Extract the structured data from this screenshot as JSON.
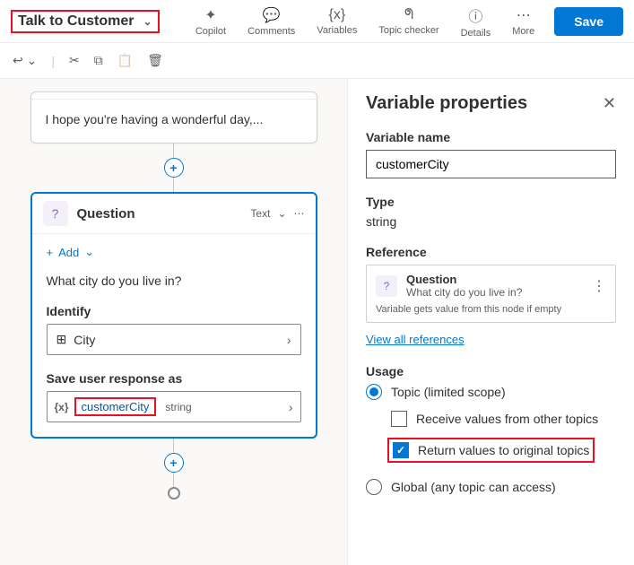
{
  "header": {
    "topic_name": "Talk to Customer",
    "tools": {
      "copilot": "Copilot",
      "comments": "Comments",
      "variables": "Variables",
      "topic_checker": "Topic checker",
      "details": "Details",
      "more": "More"
    },
    "save": "Save"
  },
  "canvas": {
    "message_text": "I hope you're having a wonderful day,...",
    "question": {
      "title": "Question",
      "type_label": "Text",
      "add_label": "Add",
      "prompt": "What city do you live in?",
      "identify_label": "Identify",
      "identify_value": "City",
      "save_response_label": "Save user response as",
      "variable_name": "customerCity",
      "variable_type": "string"
    }
  },
  "panel": {
    "title": "Variable properties",
    "name_label": "Variable name",
    "name_value": "customerCity",
    "type_label": "Type",
    "type_value": "string",
    "reference_label": "Reference",
    "reference": {
      "title": "Question",
      "subtitle": "What city do you live in?",
      "note": "Variable gets value from this node if empty"
    },
    "view_all": "View all references",
    "usage_label": "Usage",
    "usage": {
      "topic_label": "Topic (limited scope)",
      "receive_label": "Receive values from other topics",
      "return_label": "Return values to original topics",
      "global_label": "Global (any topic can access)"
    }
  }
}
